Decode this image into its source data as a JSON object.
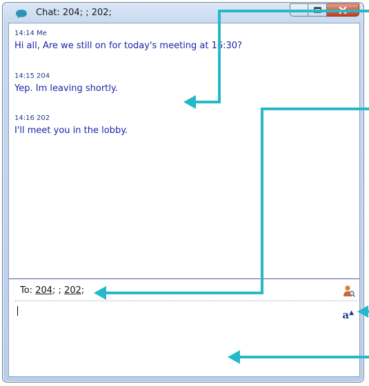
{
  "window": {
    "title": "Chat: 204; ; 202;"
  },
  "messages": [
    {
      "time": "14:14",
      "sender": "Me",
      "text": "Hi all, Are we still on for today's meeting at 16:30?"
    },
    {
      "time": "14:15",
      "sender": "204",
      "text": "Yep. Im leaving shortly."
    },
    {
      "time": "14:16",
      "sender": "202",
      "text": "I'll meet you in the lobby."
    }
  ],
  "to_row": {
    "label": "To:",
    "recipients": [
      "204",
      "202"
    ],
    "separator_a": ";",
    "separator_b": "; ;",
    "separator_c": ";"
  },
  "compose": {
    "value": ""
  },
  "icons": {
    "title": "chat-bubble-icon",
    "contacts": "user-search-icon",
    "font": "font-format-icon",
    "font_glyph": "a"
  },
  "colors": {
    "message_text": "#1b1fa8",
    "annotation_arrow": "#25b8c8",
    "close_button": "#d35a3f"
  }
}
